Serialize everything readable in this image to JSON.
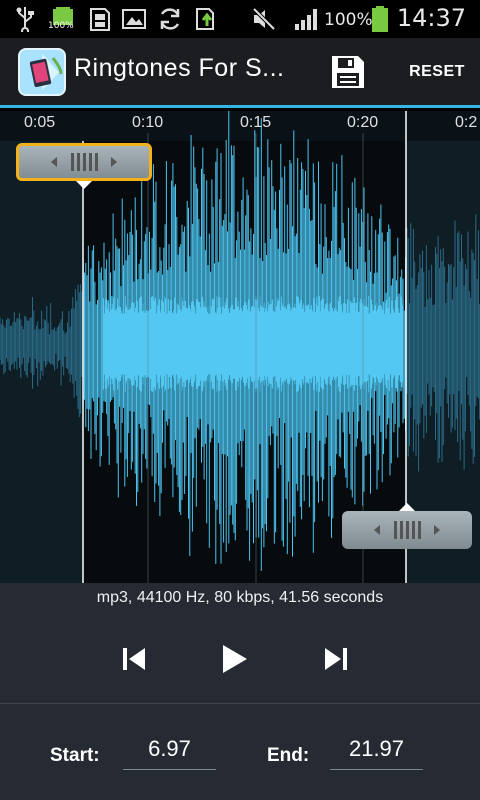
{
  "status_bar": {
    "icons": [
      "usb-icon",
      "battery-small-icon",
      "sd-card-icon",
      "image-icon",
      "sync-icon",
      "upload-icon",
      "mute-icon",
      "signal-icon",
      "battery-icon"
    ],
    "battery_badge": "100%",
    "battery_percent": "100%",
    "time": "14:37"
  },
  "action_bar": {
    "title": "Ringtones For S...",
    "save_icon": "save-icon",
    "reset_label": "RESET",
    "accent_color": "#33b5e5"
  },
  "timeline": {
    "ticks": [
      "0:05",
      "0:10",
      "0:15",
      "0:20",
      "0:2"
    ]
  },
  "selection": {
    "start_marker": "start-marker",
    "end_marker": "end-marker"
  },
  "file_info": "mp3, 44100 Hz, 80 kbps, 41.56 seconds",
  "controls": {
    "previous_icon": "skip-previous-icon",
    "play_icon": "play-icon",
    "next_icon": "skip-next-icon"
  },
  "times": {
    "start_label": "Start:",
    "start_value": "6.97",
    "end_label": "End:",
    "end_value": "21.97"
  }
}
